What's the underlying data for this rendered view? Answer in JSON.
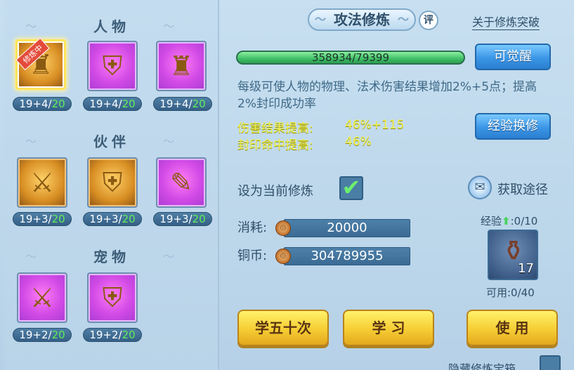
{
  "left": {
    "sections": [
      {
        "title": "人物",
        "slots": [
          {
            "badge": "修炼中",
            "level": "19+4/",
            "max": "20",
            "icon": "warrior-figure-icon",
            "selected": true
          },
          {
            "badge": "",
            "level": "19+4/",
            "max": "20",
            "icon": "shield-warrior-icon",
            "selected": false
          },
          {
            "badge": "",
            "level": "19+4/",
            "max": "20",
            "icon": "armored-warrior-icon",
            "selected": false
          }
        ]
      },
      {
        "title": "伙伴",
        "slots": [
          {
            "badge": "",
            "level": "19+3/",
            "max": "20",
            "icon": "sword-lion-icon"
          },
          {
            "badge": "",
            "level": "19+3/",
            "max": "20",
            "icon": "shield-lion-icon"
          },
          {
            "badge": "",
            "level": "19+3/",
            "max": "20",
            "icon": "scroll-lion-icon"
          }
        ]
      },
      {
        "title": "宠物",
        "slots": [
          {
            "badge": "",
            "level": "19+2/",
            "max": "20",
            "icon": "sword-pet-icon"
          },
          {
            "badge": "",
            "level": "19+2/",
            "max": "20",
            "icon": "shield-pet-icon"
          }
        ]
      }
    ]
  },
  "header": {
    "title": "攻法修炼",
    "eval_label": "评",
    "about_link": "关于修炼突破"
  },
  "progress": {
    "text": "358934/79399",
    "fill_fraction": 1.0
  },
  "buttons": {
    "awaken": "可觉醒",
    "exchange": "经验换修",
    "learn50": "学五十次",
    "learn": "学 习",
    "use": "使 用"
  },
  "description": "每级可使人物的物理、法术伤害结果增加2%+5点；提高2%封印成功率",
  "stats": [
    {
      "label": "伤害结果提高:",
      "value": "46%+115"
    },
    {
      "label": "封印命中提高:",
      "value": "46%"
    }
  ],
  "set_current": {
    "label": "设为当前修炼",
    "checked": true
  },
  "obtain": {
    "label": "获取途径"
  },
  "cost": {
    "consume_label": "消耗:",
    "consume_value": "20000",
    "coin_label": "铜币:",
    "coin_value": "304789955"
  },
  "item": {
    "exp_label": "经验",
    "exp_value": ":0/10",
    "count": "17",
    "usable": "可用:0/40"
  },
  "hide_box": {
    "label": "隐藏修炼宝箱"
  },
  "colors": {
    "accent_gold": "#f6cd34",
    "accent_blue": "#3b96e6",
    "stat_yellow": "#f1f14a",
    "level_max_green": "#5ef058"
  }
}
